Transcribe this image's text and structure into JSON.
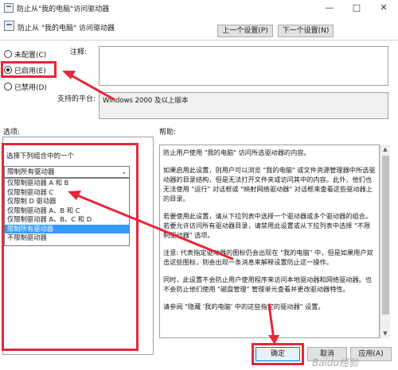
{
  "window": {
    "title": "防止从\"我的电脑\"访问驱动器",
    "minimize": "—",
    "maximize": "□",
    "close": "✕"
  },
  "header": {
    "title": "防止从 \"我的电脑\" 访问驱动器",
    "prev_label": "上一个设置(P)",
    "next_label": "下一个设置(N)"
  },
  "state": {
    "options": [
      {
        "label": "未配置(C)",
        "selected": false
      },
      {
        "label": "已启用(E)",
        "selected": true
      },
      {
        "label": "已禁用(D)",
        "selected": false
      }
    ]
  },
  "comment": {
    "label": "注释:",
    "value": ""
  },
  "platform": {
    "label": "支持的平台:",
    "value": "Windows 2000 及以上版本"
  },
  "options_label": "选项:",
  "help_label": "帮助:",
  "options_panel": {
    "prompt": "选择下列组合中的一个",
    "combo_value": "限制所有驱动器",
    "combo_arrow": "⌄",
    "items": [
      {
        "label": "仅限制驱动器 A 和 B",
        "selected": false
      },
      {
        "label": "仅限制驱动器 C",
        "selected": false
      },
      {
        "label": "仅限制 D 驱动器",
        "selected": false
      },
      {
        "label": "仅限制驱动器 A、B 和 C",
        "selected": false
      },
      {
        "label": "仅限制驱动器 A、B、C 和 D",
        "selected": false
      },
      {
        "label": "限制所有驱动器",
        "selected": true
      },
      {
        "label": "不限制驱动器",
        "selected": false
      }
    ]
  },
  "help_text": [
    "防止用户使用 \"我的电脑\" 访问所选驱动器的内容。",
    "如果启用此设置，则用户可以浏览 \"我的电脑\" 或文件资源管理器中所选驱动器的目录结构，但是无法打开文件夹或访问其中的内容。此外，他们也无法使用 \"运行\" 对话框或 \"映射网络驱动器\" 对话框来查看这些驱动器上的目录。",
    "若要使用此设置，请从下拉列表中选择一个驱动器或多个驱动器的组合。若要允许访问所有驱动器目录，请禁用此设置或从下拉列表中选择 \"不限制驱动器\" 选项。",
    "注意: 代表指定驱动器的图标仍会出现在 \"我的电脑\" 中，但是如果用户双击这些图标，则会出现一条消息来解释设置防止这一操作。",
    "同时，此设置不会防止用户使用程序来访问本地驱动器和网络驱动器。也不会防止他们使用 \"磁盘管理\" 管理单元查看并更改驱动器特性。",
    "请参阅 \"隐藏 '我的电脑' 中的这些指定的驱动器\" 设置。"
  ],
  "footer": {
    "ok_label": "确定",
    "cancel_label": "取消",
    "apply_label": "应用(A)"
  },
  "watermark": "Baidu经验",
  "colors": {
    "annotation": "#e8263a",
    "selection": "#3399ff"
  }
}
